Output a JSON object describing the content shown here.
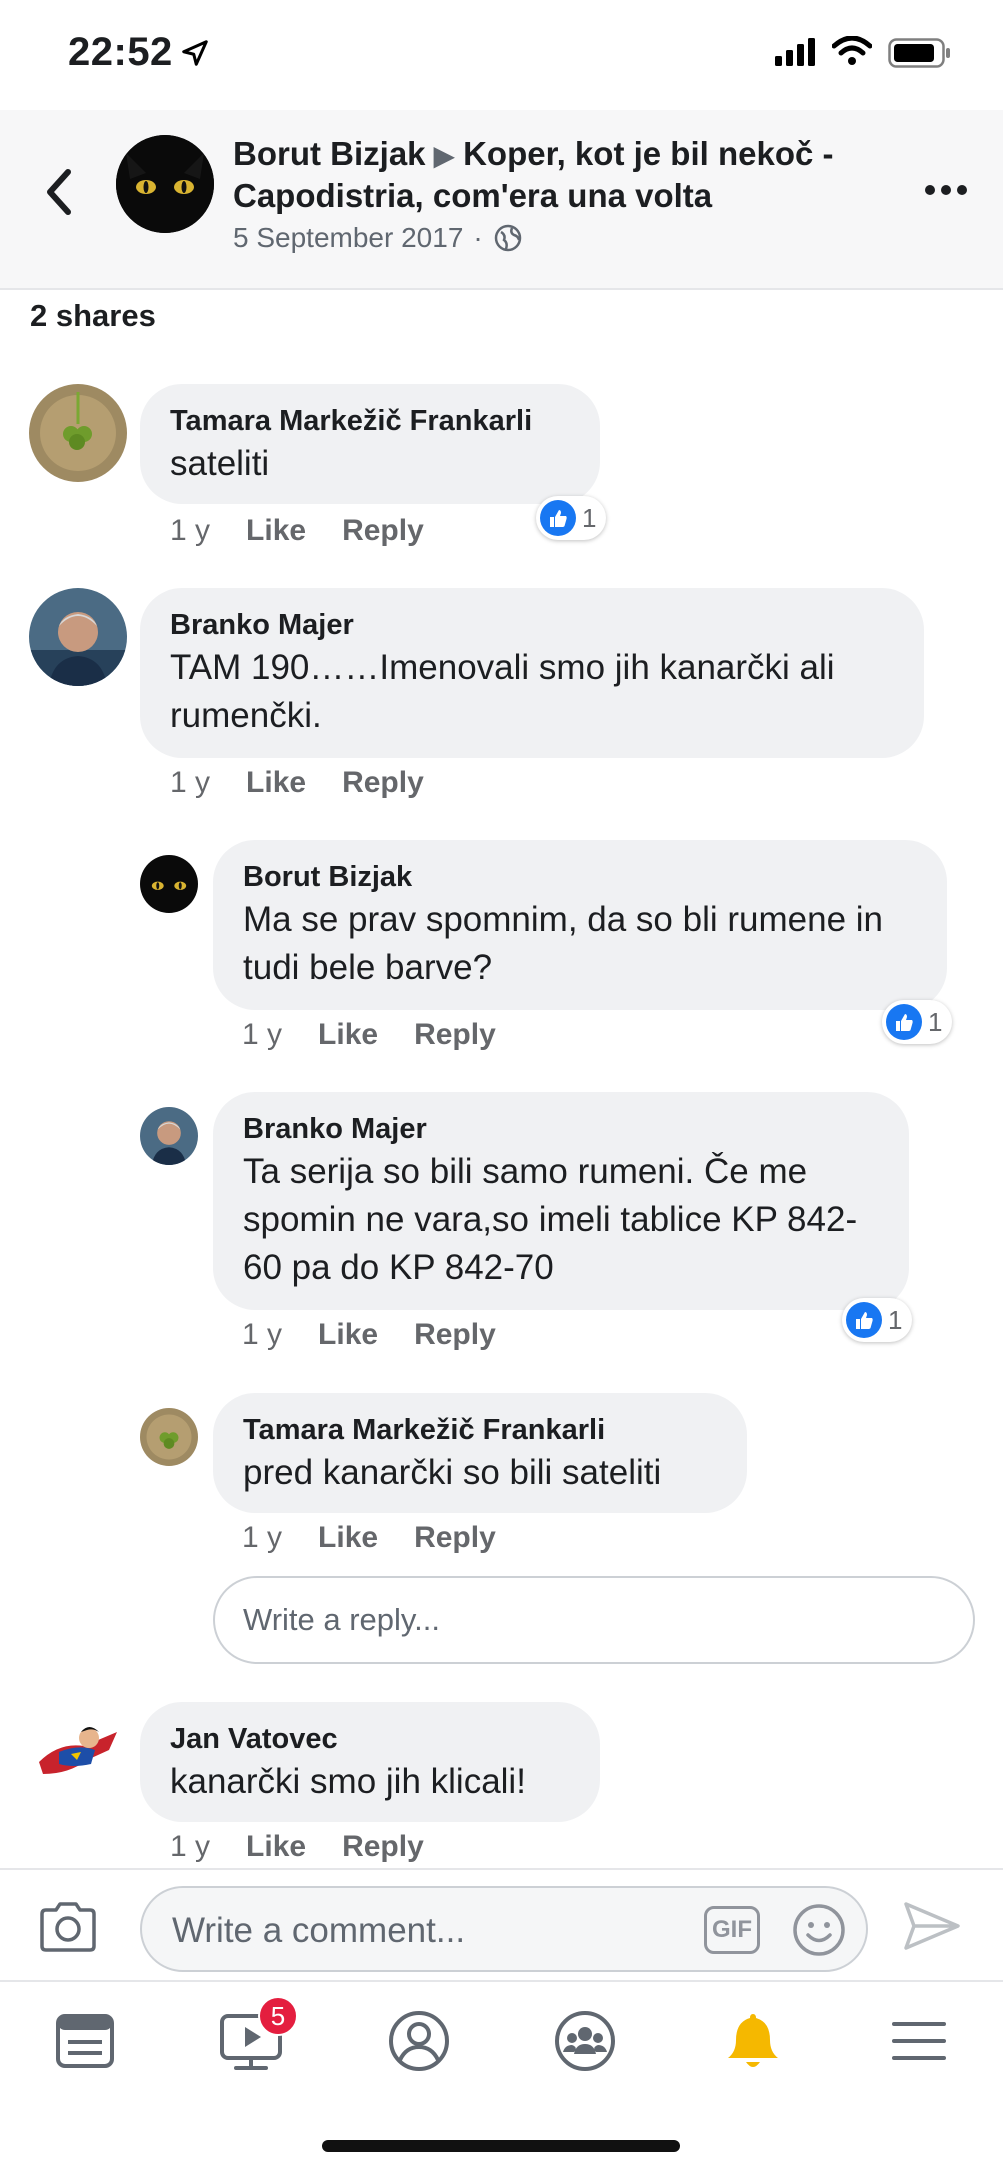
{
  "status_bar": {
    "time": "22:52"
  },
  "header": {
    "author": "Borut Bizjak",
    "group": "Koper, kot je bil nekoč - Capodistria, com'era una volta",
    "date": "5 September 2017",
    "separator": "·"
  },
  "shares": "2 shares",
  "comments": [
    {
      "name": "Tamara Markežič Frankarli",
      "text": "sateliti",
      "age": "1 y",
      "like": "Like",
      "reply": "Reply",
      "reactions": "1"
    },
    {
      "name": "Branko Majer",
      "text": "TAM 190……Imenovali smo jih kanarčki ali rumenčki.",
      "age": "1 y",
      "like": "Like",
      "reply": "Reply"
    },
    {
      "name": "Borut Bizjak",
      "text": "Ma se prav spomnim, da so bli rumene in tudi bele barve?",
      "age": "1 y",
      "like": "Like",
      "reply": "Reply",
      "reactions": "1"
    },
    {
      "name": "Branko Majer",
      "text": "Ta serija so bili samo rumeni.  Če me spomin ne vara,so imeli tablice KP 842-60 pa do KP 842-70",
      "age": "1 y",
      "like": "Like",
      "reply": "Reply",
      "reactions": "1"
    },
    {
      "name": "Tamara Markežič Frankarli",
      "text": "pred kanarčki so bili sateliti",
      "age": "1 y",
      "like": "Like",
      "reply": "Reply"
    },
    {
      "name": "Jan Vatovec",
      "text": "kanarčki smo jih klicali!",
      "age": "1 y",
      "like": "Like",
      "reply": "Reply"
    }
  ],
  "reply_input": {
    "placeholder": "Write a reply..."
  },
  "composer": {
    "placeholder": "Write a comment...",
    "gif_label": "GIF"
  },
  "tabbar": {
    "watch_badge": "5"
  },
  "colors": {
    "like_blue": "#1877f2",
    "badge_red": "#e41e3f",
    "bell_yellow": "#f5b800"
  }
}
